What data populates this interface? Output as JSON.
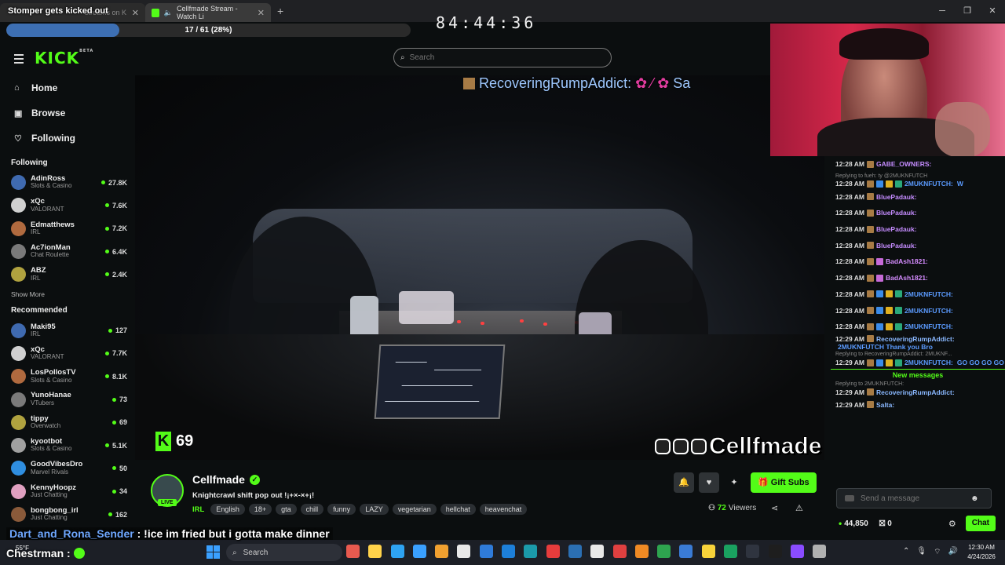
{
  "browser": {
    "tab1_title": "Stomper gets kicked out",
    "tab1_sub": "streams on K",
    "tab2_title": "Cellfmade Stream - Watch Li",
    "new_tab": "+"
  },
  "overlay": {
    "progress_text": "17 / 61 (28%)",
    "progress_fraction": 0.28,
    "timer": "84:44:36"
  },
  "kick": {
    "logo": "KICK",
    "logo_tag": "BETA",
    "search_placeholder": "Search"
  },
  "sidebar": {
    "nav": [
      {
        "label": "Home",
        "icon": "home-icon"
      },
      {
        "label": "Browse",
        "icon": "browse-icon"
      },
      {
        "label": "Following",
        "icon": "heart-icon"
      }
    ],
    "following_heading": "Following",
    "following": [
      {
        "name": "AdinRoss",
        "category": "Slots & Casino",
        "viewers": "27.8K"
      },
      {
        "name": "xQc",
        "category": "VALORANT",
        "viewers": "7.6K"
      },
      {
        "name": "Edmatthews",
        "category": "IRL",
        "viewers": "7.2K"
      },
      {
        "name": "Ac7ionMan",
        "category": "Chat Roulette",
        "viewers": "6.4K"
      },
      {
        "name": "ABZ",
        "category": "IRL",
        "viewers": "2.4K"
      }
    ],
    "show_more": "Show More",
    "recommended_heading": "Recommended",
    "recommended": [
      {
        "name": "Maki95",
        "category": "IRL",
        "viewers": "127"
      },
      {
        "name": "xQc",
        "category": "VALORANT",
        "viewers": "7.7K"
      },
      {
        "name": "LosPollosTV",
        "category": "Slots & Casino",
        "viewers": "8.1K"
      },
      {
        "name": "YunoHanae",
        "category": "VTubers",
        "viewers": "73"
      },
      {
        "name": "tippy",
        "category": "Overwatch",
        "viewers": "69"
      },
      {
        "name": "kyootbot",
        "category": "Slots & Casino",
        "viewers": "5.1K"
      },
      {
        "name": "GoodVibesDro",
        "category": "Marvel Rivals",
        "viewers": "50"
      },
      {
        "name": "KennyHoopz",
        "category": "Just Chatting",
        "viewers": "34"
      },
      {
        "name": "bongbong_irl",
        "category": "Just Chatting",
        "viewers": "162"
      }
    ]
  },
  "video": {
    "marquee_user": "RecoveringRumpAddict:",
    "marquee_tail": "Sa",
    "viewer_count": "69",
    "watermark": "Cellfmade"
  },
  "channel": {
    "name": "Cellfmade",
    "live_label": "LIVE",
    "title": "Knightcrawl shift pop out  !¡+×-×+¡!",
    "category": "IRL",
    "tags": [
      "English",
      "18+",
      "gta",
      "chill",
      "funny",
      "LAZY",
      "vegetarian",
      "hellchat",
      "heavenchat"
    ],
    "viewers": "72",
    "viewers_label": "Viewers",
    "gift_subs": "Gift Subs"
  },
  "chat": {
    "messages": [
      {
        "ts": "12:28 AM",
        "user": "GABE_OWNERS:",
        "color": "#c58cff",
        "text": "",
        "reply": ""
      },
      {
        "ts": "12:28 AM",
        "user": "2MUKNFUTCH:",
        "color": "#5b9bff",
        "text": "W",
        "reply": "Replying to fueh: ty @2MUKNFUTCH"
      },
      {
        "ts": "12:28 AM",
        "user": "BluePadauk:",
        "color": "#c58cff",
        "text": "",
        "reply": ""
      },
      {
        "ts": "12:28 AM",
        "user": "BluePadauk:",
        "color": "#c58cff",
        "text": "",
        "reply": ""
      },
      {
        "ts": "12:28 AM",
        "user": "BluePadauk:",
        "color": "#c58cff",
        "text": "",
        "reply": ""
      },
      {
        "ts": "12:28 AM",
        "user": "BluePadauk:",
        "color": "#c58cff",
        "text": "",
        "reply": ""
      },
      {
        "ts": "12:28 AM",
        "user": "BadAsh1821:",
        "color": "#d58cff",
        "text": "",
        "reply": ""
      },
      {
        "ts": "12:28 AM",
        "user": "BadAsh1821:",
        "color": "#d58cff",
        "text": "",
        "reply": ""
      },
      {
        "ts": "12:28 AM",
        "user": "2MUKNFUTCH:",
        "color": "#5b9bff",
        "text": "",
        "reply": ""
      },
      {
        "ts": "12:28 AM",
        "user": "2MUKNFUTCH:",
        "color": "#5b9bff",
        "text": "",
        "reply": ""
      },
      {
        "ts": "12:28 AM",
        "user": "2MUKNFUTCH:",
        "color": "#5b9bff",
        "text": "",
        "reply": ""
      },
      {
        "ts": "12:29 AM",
        "user": "RecoveringRumpAddict:",
        "color": "#8ab8ff",
        "text": "2MUKNFUTCH  Thank you Bro",
        "reply": ""
      },
      {
        "ts": "12:29 AM",
        "user": "2MUKNFUTCH:",
        "color": "#5b9bff",
        "text": "GO  GO  GO  GO",
        "reply": "Replying to RecoveringRumpAddict: 2MUKNF..."
      }
    ],
    "new_messages": "New messages",
    "after": [
      {
        "ts": "12:29 AM",
        "user": "RecoveringRumpAddict:",
        "color": "#8ab8ff",
        "text": "",
        "reply": "Replying to 2MUKNFUTCH:"
      },
      {
        "ts": "12:29 AM",
        "user": "Salta:",
        "color": "#8ab8ff",
        "text": "",
        "reply": ""
      }
    ],
    "input_placeholder": "Send a message",
    "points": "44,850",
    "gifts": "0",
    "chat_button": "Chat"
  },
  "stream_overlay_chat": {
    "line1_user": "Dart_and_Rona_Sender",
    "line1_text": ": !ice im fried but i gotta make dinner",
    "line2_user": "Chestrman",
    "line2_text": ":",
    "weather": "55°F"
  },
  "taskbar": {
    "search_label": "Search",
    "time": "12:30 AM",
    "date": "4/24/2026",
    "icon_colors": [
      "#e85a4f",
      "#ffd24a",
      "#2ea3f2",
      "#3aa0ff",
      "#f0a030",
      "#e8e8e8",
      "#2f7bd9",
      "#1d7fd8",
      "#1b9aaa",
      "#e63c3c",
      "#2b6fb3",
      "#e8e8e8",
      "#e04040",
      "#f08a24",
      "#2ea44f",
      "#3a7bd5",
      "#f7d23a",
      "#1aa260",
      "#2f343f",
      "#1e1e1e",
      "#8a4cff",
      "#b0b0b0"
    ]
  }
}
